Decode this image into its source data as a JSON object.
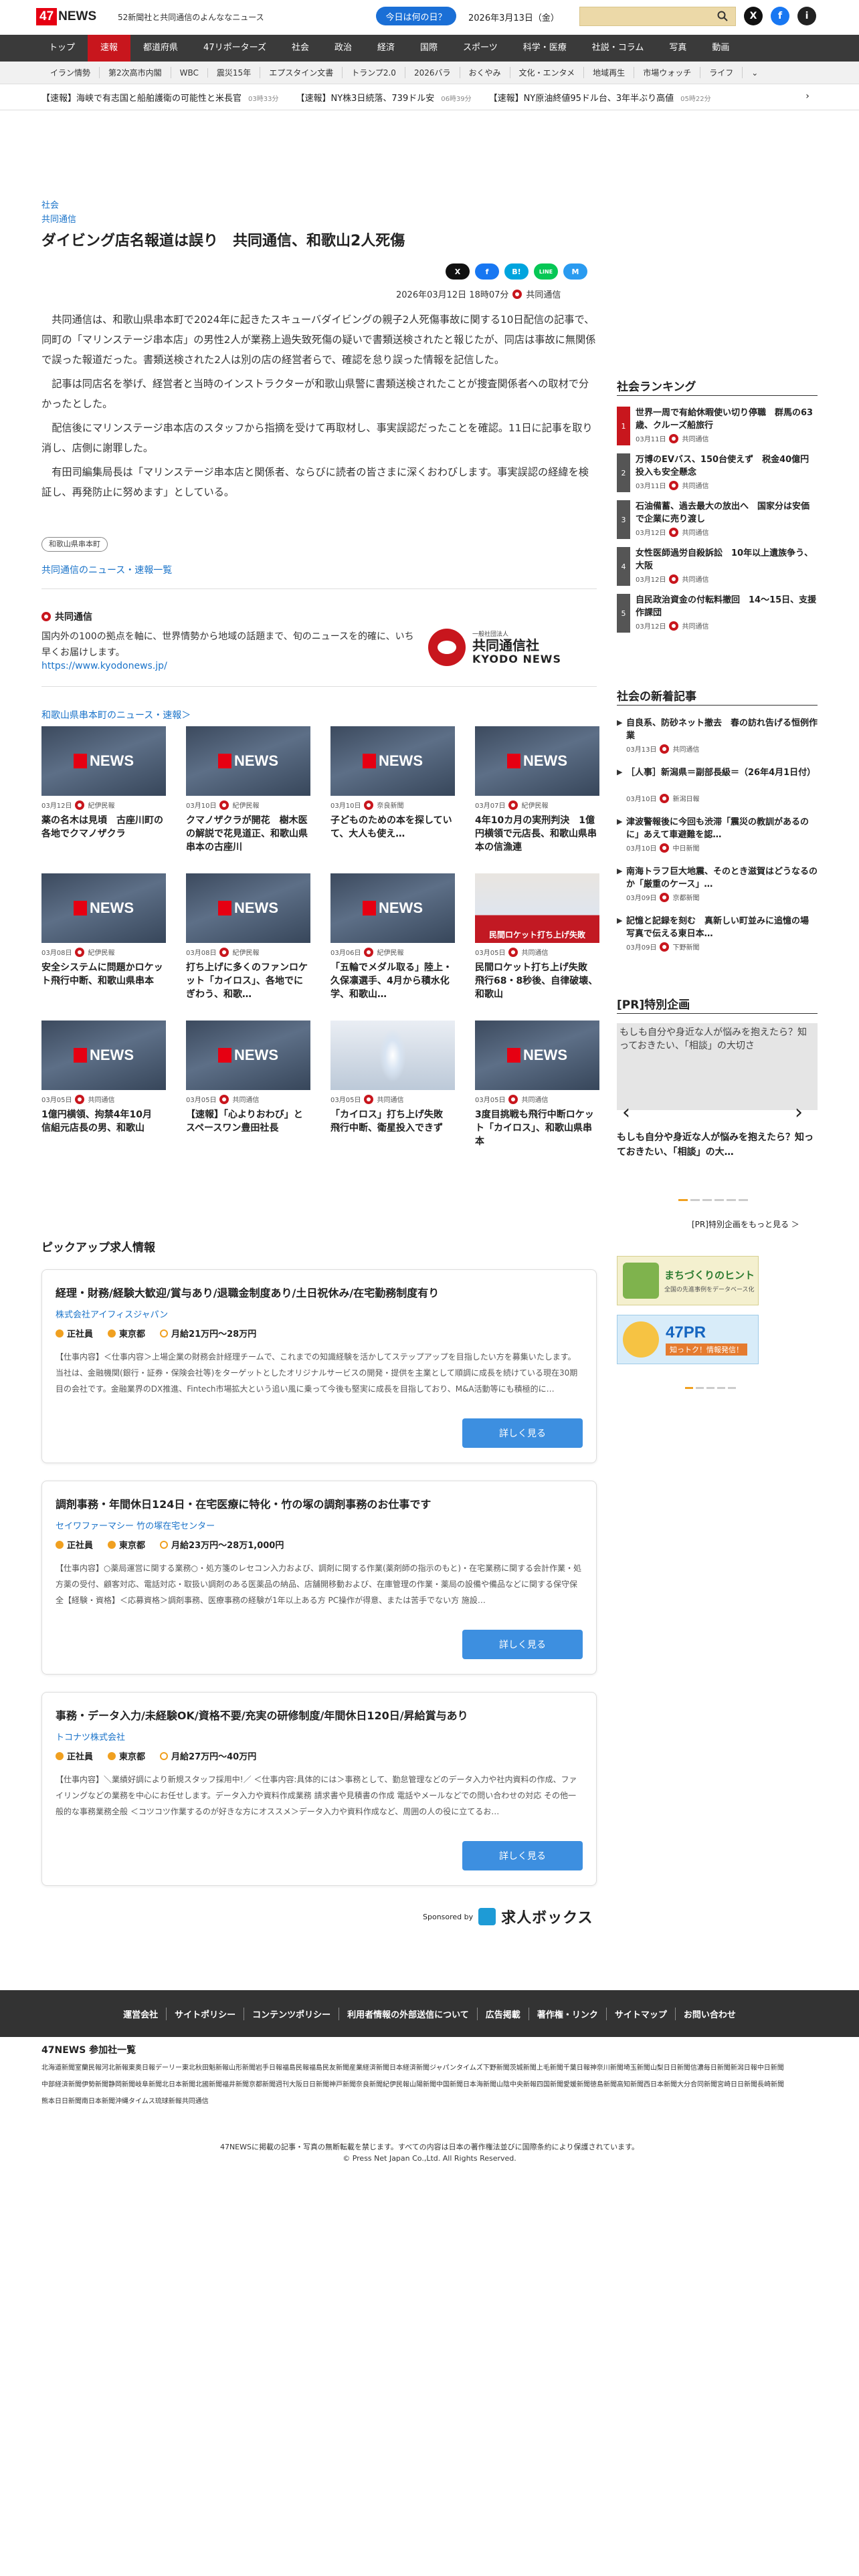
{
  "header": {
    "logo_num": "47",
    "logo_text": "NEWS",
    "tagline": "52新聞社と共同通信のよんななニュース",
    "today_button": "今日は何の日？",
    "date": "2026年3月13日（金）",
    "social": [
      "X",
      "f",
      "i"
    ]
  },
  "nav": {
    "items": [
      "トップ",
      "速報",
      "都道府県",
      "47リポーターズ",
      "社会",
      "政治",
      "経済",
      "国際",
      "スポーツ",
      "科学・医療",
      "社説・コラム",
      "写真",
      "動画"
    ],
    "active_index": 1
  },
  "subnav": [
    "イラン情勢",
    "第2次高市内閣",
    "WBC",
    "震災15年",
    "エプスタイン文書",
    "トランプ2.0",
    "2026バラ",
    "おくやみ",
    "文化・エンタメ",
    "地域再生",
    "市場ウォッチ",
    "ライフ"
  ],
  "ticker": [
    {
      "text": "【速報】海峡で有志国と船舶護衛の可能性と米長官",
      "time": "03時33分"
    },
    {
      "text": "【速報】NY株3日続落、739ドル安",
      "time": "06時39分"
    },
    {
      "text": "【速報】NY原油終値95ドル台、3年半ぶり高値",
      "time": "05時22分"
    }
  ],
  "article": {
    "category": "社会",
    "source_category": "共同通信",
    "title": "ダイビング店名報道は誤り　共同通信、和歌山2人死傷",
    "share": [
      "X",
      "f",
      "B!",
      "LINE",
      "M"
    ],
    "date": "2026年03月12日 18時07分",
    "source": "共同通信",
    "paragraphs": [
      "共同通信は、和歌山県串本町で2024年に起きたスキューバダイビングの親子2人死傷事故に関する10日配信の記事で、同町の「マリンステージ串本店」の男性2人が業務上過失致死傷の疑いで書類送検されたと報じたが、同店は事故に無関係で誤った報道だった。書類送検された2人は別の店の経営者らで、確認を怠り誤った情報を記信した。",
      "記事は同店名を挙げ、経営者と当時のインストラクターが和歌山県警に書類送検されたことが捜査関係者への取材で分かったとした。",
      "配信後にマリンステージ串本店のスタッフから指摘を受けて再取材し、事実誤認だったことを確認。11日に記事を取り消し、店側に謝罪した。",
      "有田司編集局長は「マリンステージ串本店と関係者、ならびに読者の皆さまに深くおわびします。事実誤認の経緯を検証し、再発防止に努めます」としている。"
    ],
    "tag": "和歌山県串本町",
    "kyodo_news_link": "共同通信のニュース・速報一覧"
  },
  "source_box": {
    "name": "共同通信",
    "description": "国内外の100の拠点を軸に、世界情勢から地域の話題まで、旬のニュースを的確に、いち早くお届けします。",
    "url": "https://www.kyodonews.jp/",
    "logo_small": "一般社団法人",
    "logo_jp": "共同通信社",
    "logo_en": "KYODO NEWS"
  },
  "grid": {
    "title": "和歌山県串本町のニュース・速報＞",
    "items": [
      {
        "date": "03月12日",
        "source": "紀伊民報",
        "title": "薬の名木は見頃　古座川町の各地でクマノザクラ",
        "thumb": "47"
      },
      {
        "date": "03月10日",
        "source": "紀伊民報",
        "title": "クマノザクラが開花　樹木医の解説で花見道正、和歌山県串本の古座川",
        "thumb": "47"
      },
      {
        "date": "03月10日",
        "source": "奈良新聞",
        "title": "子どものための本を探していて、大人も使え…",
        "thumb": "47"
      },
      {
        "date": "03月07日",
        "source": "紀伊民報",
        "title": "4年10カ月の実刑判決　1億円横領で元店長、和歌山県串本の信漁連",
        "thumb": "47"
      },
      {
        "date": "03月08日",
        "source": "紀伊民報",
        "title": "安全システムに問題かロケット飛行中断、和歌山県串本",
        "thumb": "47"
      },
      {
        "date": "03月08日",
        "source": "紀伊民報",
        "title": "打ち上げに多くのファンロケット「カイロス」、各地でにぎわう、和歌…",
        "thumb": "47"
      },
      {
        "date": "03月06日",
        "source": "紀伊民報",
        "title": "「五輪でメダル取る」陸上・久保凛選手、4月から積水化学、和歌山…",
        "thumb": "47"
      },
      {
        "date": "03月05日",
        "source": "共同通信",
        "title": "民間ロケット打ち上げ失敗　飛行68・8秒後、自律破壊、和歌山",
        "thumb": "rocket",
        "caption": "民間ロケット打ち上げ失敗"
      },
      {
        "date": "03月05日",
        "source": "共同通信",
        "title": "1億円横領、拘禁4年10月　信組元店長の男、和歌山",
        "thumb": "47"
      },
      {
        "date": "03月05日",
        "source": "共同通信",
        "title": "【速報】「心よりおわび」とスペースワン豊田社長",
        "thumb": "47"
      },
      {
        "date": "03月05日",
        "source": "共同通信",
        "title": "「カイロス」打ち上げ失敗　飛行中断、衛星投入できず",
        "thumb": "sky"
      },
      {
        "date": "03月05日",
        "source": "共同通信",
        "title": "3度目挑戦も飛行中断ロケット「カイロス」、和歌山県串本",
        "thumb": "47"
      }
    ]
  },
  "jobs": {
    "title": "ピックアップ求人情報",
    "detail_label": "詳しく見る",
    "items": [
      {
        "title": "経理・財務/経験大歓迎/賞与あり/退職金制度あり/土日祝休み/在宅勤務制度有り",
        "company": "株式会社アイフィスジャパン",
        "type": "正社員",
        "place": "東京都",
        "salary": "月給21万円〜28万円",
        "desc": "【仕事内容】＜仕事内容＞上場企業の財務会計経理チームで、これまでの知識経験を活かしてステップアップを目指したい方を募集いたします。当社は、金融機関(銀行・証券・保険会社等)をターゲットとしたオリジナルサービスの開発・提供を主業として順調に成長を続けている現在30期目の会社です。金融業界のDX推進、Fintech市場拡大という追い風に乗って今後も堅実に成長を目指しており、M&A活動等にも積極的に…"
      },
      {
        "title": "調剤事務・年間休日124日・在宅医療に特化・竹の塚の調剤事務のお仕事です",
        "company": "セイワファーマシー 竹の塚在宅センター",
        "type": "正社員",
        "place": "東京都",
        "salary": "月給23万円〜28万1,000円",
        "desc": "【仕事内容】○薬局運営に関する業務○・処方箋のレセコン入力および、調剤に関する作業(薬剤師の指示のもと)・在宅業務に関する会計作業・処方薬の受付、顧客対応、電話対応・取扱い調剤のある医薬品の納品、店舗開移動および、在庫管理の作業・薬局の設備や備品などに関する保守保全【経験・資格】＜応募資格＞調剤事務、医療事務の経験が1年以上ある方 PC操作が得意、または苦手でない方 施設…"
      },
      {
        "title": "事務・データ入力/未経験OK/資格不要/充実の研修制度/年間休日120日/昇給賞与あり",
        "company": "トコナツ株式会社",
        "type": "正社員",
        "place": "東京都",
        "salary": "月給27万円〜40万円",
        "desc": "【仕事内容】＼業績好調により新規スタッフ採用中!／ ＜仕事内容:具体的には＞事務として、勤怠管理などのデータ入力や社内資料の作成、ファイリングなどの業務を中心にお任せします。データ入力や資料作成業務 請求書や見積書の作成 電話やメールなどでの問い合わせの対応 その他一般的な事務業務全般 ＜コツコツ作業するのが好きな方にオススメ＞データ入力や資料作成など、周囲の人の役に立てるお…"
      }
    ],
    "sponsored_label": "Sponsored by",
    "sponsor_name": "求人ボックス"
  },
  "sidebar": {
    "ranking_title": "社会ランキング",
    "ranking": [
      {
        "num": "1",
        "title": "世界一周で有給休暇使い切り停職　群馬の63歳、クルーズ船旅行",
        "date": "03月11日",
        "source": "共同通信"
      },
      {
        "num": "2",
        "title": "万博のEVバス、150台使えず　税金40億円投入も安全懸念",
        "date": "03月11日",
        "source": "共同通信"
      },
      {
        "num": "3",
        "title": "石油備蓄、過去最大の放出へ　国家分は安価で企業に売り渡し",
        "date": "03月12日",
        "source": "共同通信"
      },
      {
        "num": "4",
        "title": "女性医師過労自殺訴訟　10年以上遺族争う、大阪",
        "date": "03月12日",
        "source": "共同通信"
      },
      {
        "num": "5",
        "title": "自民政治資金の付転料撤回　14〜15日、支援作課団",
        "date": "03月12日",
        "source": "共同通信"
      }
    ],
    "news_title": "社会の新着記事",
    "news": [
      {
        "title": "自良系、防砂ネット撤去　春の訪れ告げる恒例作業",
        "date": "03月13日",
        "source": "共同通信"
      },
      {
        "title": "［人事］新潟県＝副部長級＝（26年4月1日付）",
        "date": "03月10日",
        "source": "新潟日報"
      },
      {
        "title": "津波警報後に今回も渋滞「震災の教訓があるのに」あえて車避難を認…",
        "date": "03月10日",
        "source": "中日新聞"
      },
      {
        "title": "南海トラフ巨大地震、そのとき滋賀はどうなるのか「厳重のケース」…",
        "date": "03月09日",
        "source": "京都新聞"
      },
      {
        "title": "記憶と記録を刻む　真新しい町並みに追憶の場　写真で伝える東日本…",
        "date": "03月09日",
        "source": "下野新聞"
      }
    ],
    "pr_title": "[PR]特別企画",
    "pr_image_alt": "もしも自分や身近な人が悩みを抱えたら？知っておきたい、「相談」の大切さ",
    "pr_caption": "もしも自分や身近な人が悩みを抱えたら？知っておきたい、「相談」の大…",
    "pr_more": "[PR]特別企画をもっと見る ＞",
    "banner1": "まちづくりのヒント",
    "banner1_sub": "全国の先進事例をデータベース化",
    "banner2_a": "47PR",
    "banner2_b": "知っトク！情報発信！"
  },
  "footer": {
    "links": [
      "運営会社",
      "サイトポリシー",
      "コンテンツポリシー",
      "利用者情報の外部送信について",
      "広告掲載",
      "著作権・リンク",
      "サイトマップ",
      "お問い合わせ"
    ],
    "members_title": "47NEWS 参加社一覧",
    "members": [
      "北海道新聞",
      "室蘭民報",
      "河北新報",
      "東奥日報",
      "デーリー東北",
      "秋田魁新報",
      "山形新聞",
      "岩手日報",
      "福島民報",
      "福島民友新聞",
      "産業経済新聞",
      "日本経済新聞",
      "ジャパンタイムズ",
      "下野新聞",
      "茨城新聞",
      "上毛新聞",
      "千葉日報",
      "神奈川新聞",
      "埼玉新聞",
      "山梨日日新聞",
      "信濃毎日新聞",
      "新潟日報",
      "中日新聞",
      "中部経済新聞",
      "伊勢新聞",
      "静岡新聞",
      "岐阜新聞",
      "北日本新聞",
      "北國新聞",
      "福井新聞",
      "京都新聞",
      "週刊大阪日日新聞",
      "神戸新聞",
      "奈良新聞",
      "紀伊民報",
      "山陽新聞",
      "中国新聞",
      "日本海新聞",
      "山陰中央新報",
      "四国新聞",
      "愛媛新聞",
      "徳島新聞",
      "高知新聞",
      "西日本新聞",
      "大分合同新聞",
      "宮崎日日新聞",
      "長崎新聞",
      "熊本日日新聞",
      "南日本新聞",
      "沖縄タイムス",
      "琉球新報",
      "共同通信"
    ],
    "copy1": "47NEWSに掲載の記事・写真の無断転載を禁じます。すべての内容は日本の著作権法並びに国際条約により保護されています。",
    "copy2": "© Press Net Japan Co.,Ltd. All Rights Reserved."
  }
}
